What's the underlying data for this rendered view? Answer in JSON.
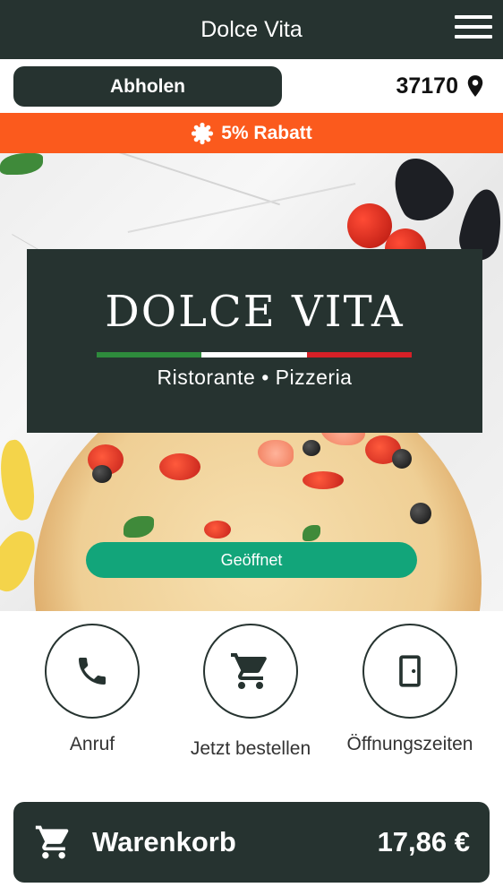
{
  "header": {
    "title": "Dolce Vita",
    "menu_icon": "hamburger-menu-icon"
  },
  "order_mode": {
    "pickup_label": "Abholen",
    "postal_code": "37170",
    "location_icon": "location-pin-icon"
  },
  "promo": {
    "icon": "sun-badge-icon",
    "text": "5% Rabatt"
  },
  "hero": {
    "logo_name": "DOLCE VITA",
    "logo_subtitle": "Ristorante • Pizzeria",
    "flag_colors": [
      "#2e8b3c",
      "#ffffff",
      "#d62027"
    ],
    "status_label": "Geöffnet"
  },
  "actions": [
    {
      "label": "Anruf",
      "icon": "phone-icon"
    },
    {
      "label": "Jetzt bestellen",
      "icon": "shopping-cart-icon"
    },
    {
      "label": "Öffnungszeiten",
      "icon": "door-icon"
    }
  ],
  "cart": {
    "icon": "shopping-cart-icon",
    "label": "Warenkorb",
    "total": "17,86 €"
  },
  "colors": {
    "primary": "#263330",
    "promo": "#fb5a1d",
    "open_status": "#12a57a"
  }
}
